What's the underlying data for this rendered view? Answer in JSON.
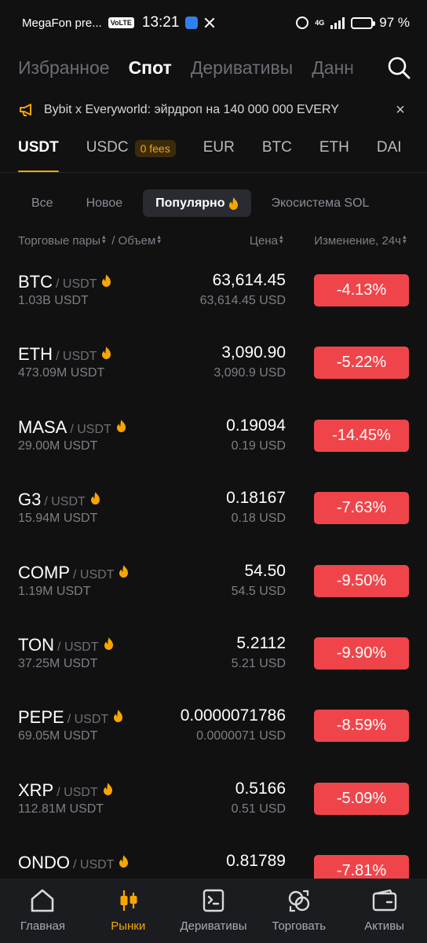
{
  "status": {
    "carrier": "MegaFon pre...",
    "volte": "VoLTE",
    "time": "13:21",
    "network": "4G",
    "battery": "97 %",
    "battery_level": 0.97
  },
  "top_nav": {
    "tabs": [
      "Избранное",
      "Спот",
      "Деривативы",
      "Данн"
    ],
    "active_index": 1
  },
  "banner": {
    "text": "Bybit x Everyworld: эйрдроп на 140 000 000 EVERY",
    "close": "×"
  },
  "quote_tabs": [
    {
      "label": "USDT",
      "active": true
    },
    {
      "label": "USDC",
      "badge": "0 fees"
    },
    {
      "label": "EUR"
    },
    {
      "label": "BTC"
    },
    {
      "label": "ETH"
    },
    {
      "label": "DAI"
    }
  ],
  "filters": [
    {
      "label": "Все"
    },
    {
      "label": "Новое"
    },
    {
      "label": "Популярно",
      "active": true
    },
    {
      "label": "Экосистема SOL"
    }
  ],
  "columns": {
    "pairs": "Торговые пары",
    "separator": "/",
    "volume": "Объем",
    "price": "Цена",
    "change": "Изменение, 24ч"
  },
  "rows": [
    {
      "symbol": "BTC",
      "quote": "/ USDT",
      "volume": "1.03B USDT",
      "price": "63,614.45",
      "fiat": "63,614.45 USD",
      "change": "-4.13%"
    },
    {
      "symbol": "ETH",
      "quote": "/ USDT",
      "volume": "473.09M USDT",
      "price": "3,090.90",
      "fiat": "3,090.9 USD",
      "change": "-5.22%"
    },
    {
      "symbol": "MASA",
      "quote": "/ USDT",
      "volume": "29.00M USDT",
      "price": "0.19094",
      "fiat": "0.19 USD",
      "change": "-14.45%"
    },
    {
      "symbol": "G3",
      "quote": "/ USDT",
      "volume": "15.94M USDT",
      "price": "0.18167",
      "fiat": "0.18 USD",
      "change": "-7.63%"
    },
    {
      "symbol": "COMP",
      "quote": "/ USDT",
      "volume": "1.19M USDT",
      "price": "54.50",
      "fiat": "54.5 USD",
      "change": "-9.50%"
    },
    {
      "symbol": "TON",
      "quote": "/ USDT",
      "volume": "37.25M USDT",
      "price": "5.2112",
      "fiat": "5.21 USD",
      "change": "-9.90%"
    },
    {
      "symbol": "PEPE",
      "quote": "/ USDT",
      "volume": "69.05M USDT",
      "price": "0.0000071786",
      "fiat": "0.0000071 USD",
      "change": "-8.59%"
    },
    {
      "symbol": "XRP",
      "quote": "/ USDT",
      "volume": "112.81M USDT",
      "price": "0.5166",
      "fiat": "0.51 USD",
      "change": "-5.09%"
    },
    {
      "symbol": "ONDO",
      "quote": "/ USDT",
      "volume": "",
      "price": "0.81789",
      "fiat": "",
      "change": "-7.81%"
    }
  ],
  "bottom_nav": [
    {
      "label": "Главная",
      "icon": "home-icon"
    },
    {
      "label": "Рынки",
      "icon": "candlestick-icon",
      "active": true
    },
    {
      "label": "Деривативы",
      "icon": "terminal-doc-icon"
    },
    {
      "label": "Торговать",
      "icon": "trade-swap-icon"
    },
    {
      "label": "Активы",
      "icon": "wallet-icon"
    }
  ],
  "colors": {
    "background": "#111112",
    "accent": "#f7a600",
    "negative": "#ef454a",
    "muted_text": "#7d7f86",
    "bottom_bar": "#1b1c20"
  }
}
